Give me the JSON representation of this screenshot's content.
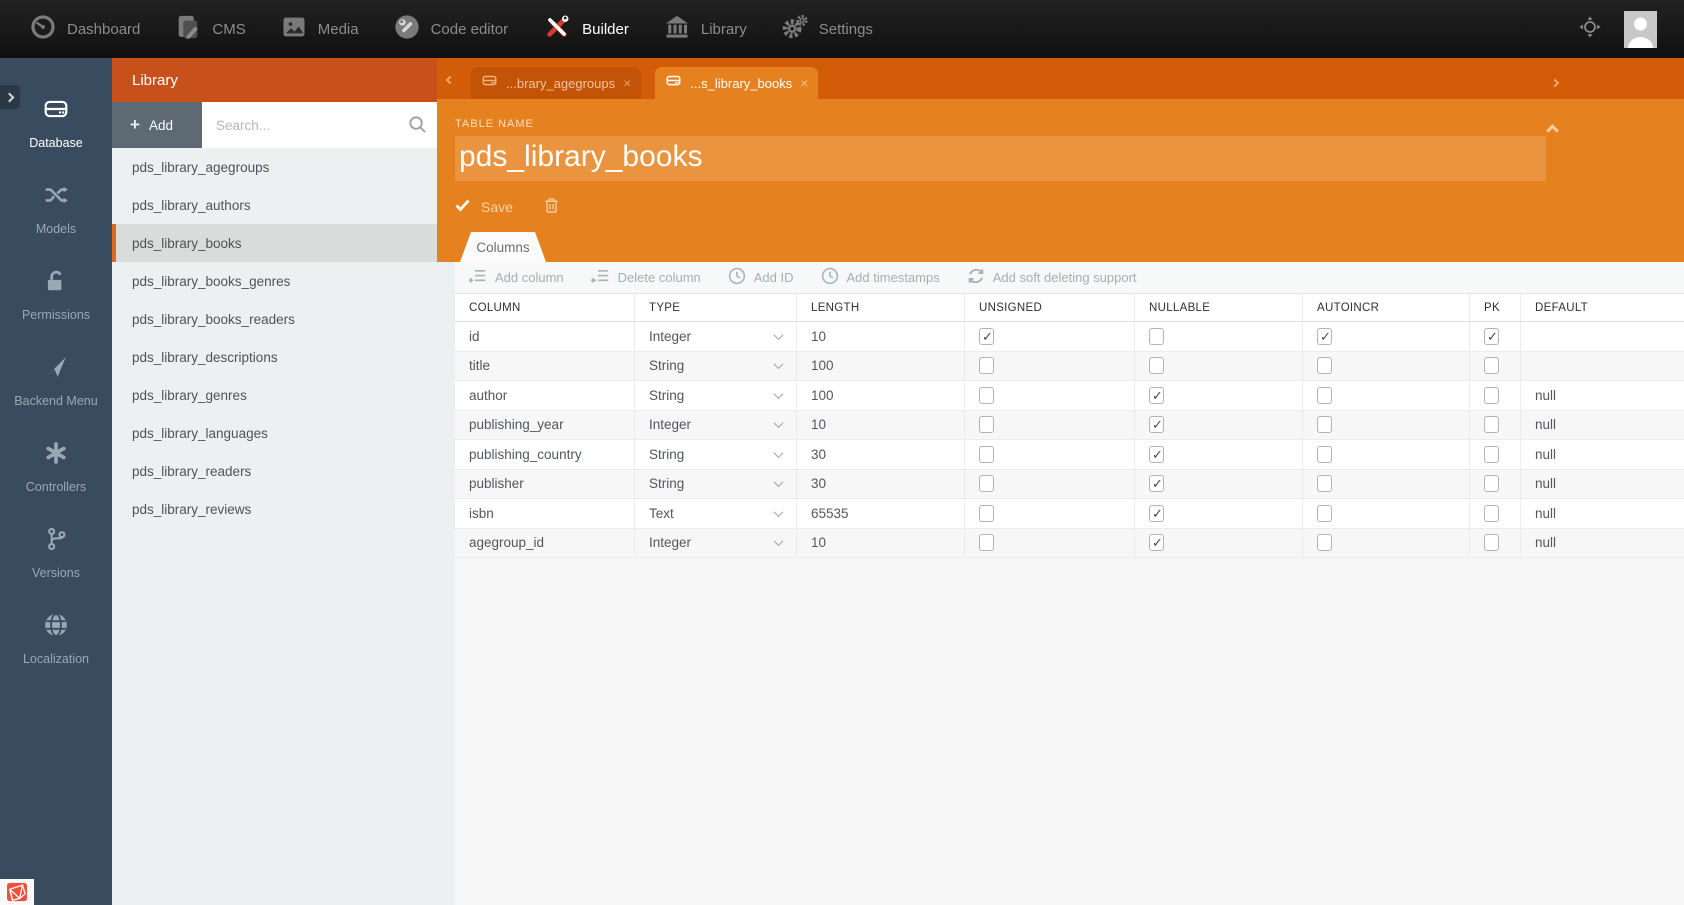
{
  "colors": {
    "accent_orange": "#e6811f",
    "panel_header_orange": "#c8501b",
    "tabstrip_orange": "#d25c08",
    "selected_item_accent": "#dd6b1f",
    "sidebar_dark": "#394b5e",
    "navbar_black": "#151515",
    "laravel_red": "#f04f3c"
  },
  "navbar": {
    "items": [
      {
        "label": "Dashboard",
        "icon": "gauge-icon",
        "active": false
      },
      {
        "label": "CMS",
        "icon": "pages-icon",
        "active": false
      },
      {
        "label": "Media",
        "icon": "image-icon",
        "active": false
      },
      {
        "label": "Code editor",
        "icon": "wrench-circle-icon",
        "active": false
      },
      {
        "label": "Builder",
        "icon": "tools-icon",
        "active": true
      },
      {
        "label": "Library",
        "icon": "bank-icon",
        "active": false
      },
      {
        "label": "Settings",
        "icon": "gears-icon",
        "active": false
      }
    ]
  },
  "sidebar": {
    "items": [
      {
        "label": "Database",
        "icon": "database-icon",
        "active": true
      },
      {
        "label": "Models",
        "icon": "shuffle-icon",
        "active": false
      },
      {
        "label": "Permissions",
        "icon": "unlock-icon",
        "active": false
      },
      {
        "label": "Backend Menu",
        "icon": "send-icon",
        "active": false
      },
      {
        "label": "Controllers",
        "icon": "asterisk-icon",
        "active": false
      },
      {
        "label": "Versions",
        "icon": "branch-icon",
        "active": false
      },
      {
        "label": "Localization",
        "icon": "globe-icon",
        "active": false
      }
    ]
  },
  "panel": {
    "title": "Library",
    "add_label": "Add",
    "search_placeholder": "Search...",
    "selected_index": 2,
    "tables": [
      "pds_library_agegroups",
      "pds_library_authors",
      "pds_library_books",
      "pds_library_books_genres",
      "pds_library_books_readers",
      "pds_library_descriptions",
      "pds_library_genres",
      "pds_library_languages",
      "pds_library_readers",
      "pds_library_reviews"
    ]
  },
  "main": {
    "tabs": [
      {
        "label": "...brary_agegroups",
        "active": false
      },
      {
        "label": "...s_library_books",
        "active": true
      }
    ],
    "table_name_label": "TABLE NAME",
    "table_name_value": "pds_library_books",
    "save_label": "Save",
    "columns_tab_label": "Columns",
    "toolbar": [
      {
        "label": "Add column",
        "icon": "add-column-icon"
      },
      {
        "label": "Delete column",
        "icon": "delete-column-icon"
      },
      {
        "label": "Add ID",
        "icon": "clock-icon"
      },
      {
        "label": "Add timestamps",
        "icon": "clock-icon"
      },
      {
        "label": "Add soft deleting support",
        "icon": "refresh-icon"
      }
    ],
    "grid": {
      "headers": [
        "COLUMN",
        "TYPE",
        "LENGTH",
        "UNSIGNED",
        "NULLABLE",
        "AUTOINCR",
        "PK",
        "DEFAULT"
      ],
      "rows": [
        {
          "column": "id",
          "type": "Integer",
          "length": "10",
          "unsigned": true,
          "nullable": false,
          "autoincr": true,
          "pk": true,
          "default": ""
        },
        {
          "column": "title",
          "type": "String",
          "length": "100",
          "unsigned": false,
          "nullable": false,
          "autoincr": false,
          "pk": false,
          "default": ""
        },
        {
          "column": "author",
          "type": "String",
          "length": "100",
          "unsigned": false,
          "nullable": true,
          "autoincr": false,
          "pk": false,
          "default": "null"
        },
        {
          "column": "publishing_year",
          "type": "Integer",
          "length": "10",
          "unsigned": false,
          "nullable": true,
          "autoincr": false,
          "pk": false,
          "default": "null"
        },
        {
          "column": "publishing_country",
          "type": "String",
          "length": "30",
          "unsigned": false,
          "nullable": true,
          "autoincr": false,
          "pk": false,
          "default": "null"
        },
        {
          "column": "publisher",
          "type": "String",
          "length": "30",
          "unsigned": false,
          "nullable": true,
          "autoincr": false,
          "pk": false,
          "default": "null"
        },
        {
          "column": "isbn",
          "type": "Text",
          "length": "65535",
          "unsigned": false,
          "nullable": true,
          "autoincr": false,
          "pk": false,
          "default": "null"
        },
        {
          "column": "agegroup_id",
          "type": "Integer",
          "length": "10",
          "unsigned": false,
          "nullable": true,
          "autoincr": false,
          "pk": false,
          "default": "null"
        }
      ]
    }
  }
}
